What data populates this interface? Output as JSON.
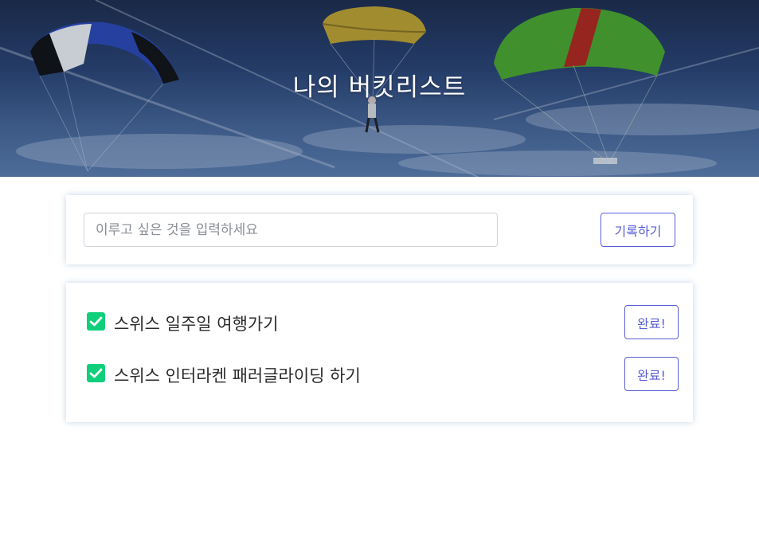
{
  "hero": {
    "title": "나의 버킷리스트"
  },
  "form": {
    "placeholder": "이루고 싶은 것을 입력하세요",
    "value": "",
    "submit_label": "기록하기"
  },
  "bucket_list": {
    "items": [
      {
        "text": "스위스 일주일 여행가기",
        "checked": true,
        "button_label": "완료!"
      },
      {
        "text": "스위스 인터라켄 패러글라이딩 하기",
        "checked": true,
        "button_label": "완료!"
      }
    ]
  },
  "colors": {
    "accent": "#5a5fd6",
    "check": "#0fcf7a",
    "sky": "#2b4475"
  }
}
